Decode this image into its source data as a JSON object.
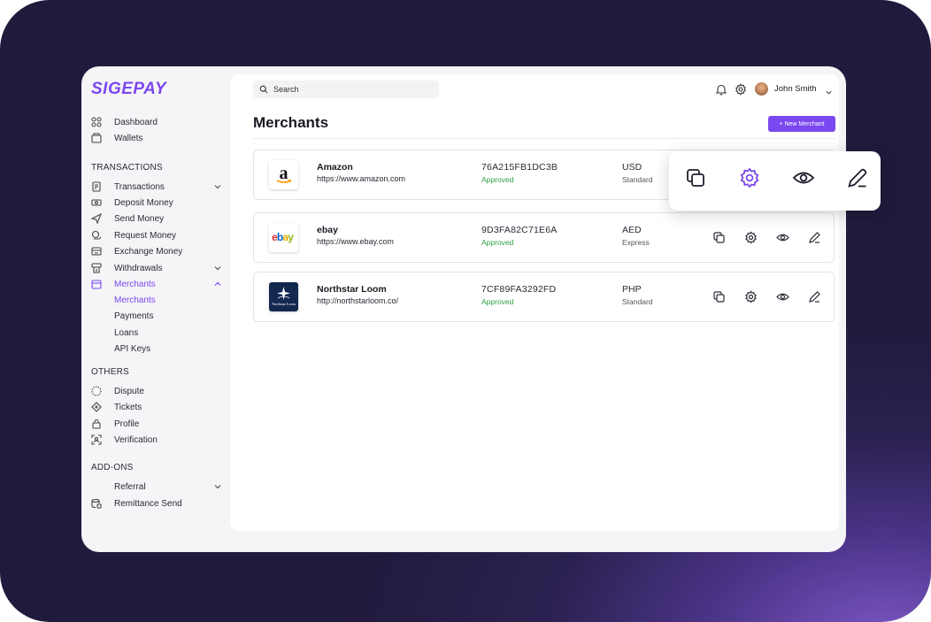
{
  "brand": {
    "name": "SIGEPAY",
    "accent": "#7b47f0"
  },
  "sidebar": {
    "top_items": [
      {
        "label": "Dashboard",
        "icon": "dashboard-grid-icon"
      },
      {
        "label": "Wallets",
        "icon": "wallet-icon"
      }
    ],
    "sections": {
      "transactions": "TRANSACTIONS",
      "others": "OTHERS",
      "addons": "ADD-ONS"
    },
    "transaction_items": [
      {
        "label": "Transactions",
        "icon": "receipt-icon",
        "chevron": "down"
      },
      {
        "label": "Deposit Money",
        "icon": "deposit-icon"
      },
      {
        "label": "Send Money",
        "icon": "send-icon"
      },
      {
        "label": "Request Money",
        "icon": "request-money-icon"
      },
      {
        "label": "Exchange Money",
        "icon": "exchange-icon"
      },
      {
        "label": "Withdrawals",
        "icon": "withdraw-icon",
        "chevron": "down"
      },
      {
        "label": "Merchants",
        "icon": "merchants-icon",
        "chevron": "up",
        "active": true
      }
    ],
    "merchant_sub": [
      {
        "label": "Merchants",
        "active": true
      },
      {
        "label": "Payments"
      },
      {
        "label": "Loans"
      },
      {
        "label": "API Keys"
      }
    ],
    "other_items": [
      {
        "label": "Dispute",
        "icon": "dispute-icon"
      },
      {
        "label": "Tickets",
        "icon": "ticket-icon"
      },
      {
        "label": "Profile",
        "icon": "lock-icon"
      },
      {
        "label": "Verification",
        "icon": "face-scan-icon"
      }
    ],
    "addon_items": [
      {
        "label": "Referral",
        "chevron": "down"
      },
      {
        "label": "Remittance Send",
        "icon": "remittance-icon"
      }
    ]
  },
  "header": {
    "search_label": "Search",
    "user_name": "John Smith"
  },
  "page": {
    "title": "Merchants",
    "new_button": "+ New Merchant"
  },
  "merchants": [
    {
      "name": "Amazon",
      "url": "https://www.amazon.com",
      "id": "76A215FB1DC3B",
      "status": "Approved",
      "currency": "USD",
      "plan": "Standard",
      "logo": "amazon-logo"
    },
    {
      "name": "ebay",
      "url": "https://www.ebay.com",
      "id": "9D3FA82C71E6A",
      "status": "Approved",
      "currency": "AED",
      "plan": "Express",
      "logo": "ebay-logo"
    },
    {
      "name": "Northstar Loom",
      "url": "http://northstarloom.co/",
      "id": "7CF89FA3292FD",
      "status": "Approved",
      "currency": "PHP",
      "plan": "Standard",
      "logo": "northstar-loom-logo",
      "logo_text": "Northstar Loom"
    }
  ],
  "colors": {
    "approved": "#2ea043",
    "accent": "#7b47f0"
  }
}
